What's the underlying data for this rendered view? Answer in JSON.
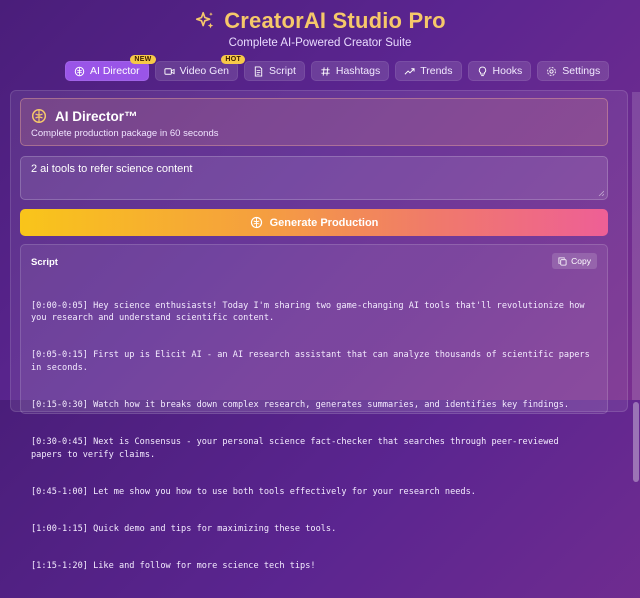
{
  "app": {
    "title": "CreatorAI Studio Pro",
    "subtitle": "Complete AI-Powered Creator Suite",
    "accent": "#9a55e8",
    "title_color": "#f6c86a"
  },
  "tabs": [
    {
      "label": "AI Director",
      "icon": "brain-icon",
      "badge": "NEW",
      "active": true
    },
    {
      "label": "Video Gen",
      "icon": "video-icon",
      "badge": "HOT",
      "active": false
    },
    {
      "label": "Script",
      "icon": "document-icon",
      "badge": "",
      "active": false
    },
    {
      "label": "Hashtags",
      "icon": "hash-icon",
      "badge": "",
      "active": false
    },
    {
      "label": "Trends",
      "icon": "trend-icon",
      "badge": "",
      "active": false
    },
    {
      "label": "Hooks",
      "icon": "lightbulb-icon",
      "badge": "",
      "active": false
    },
    {
      "label": "Settings",
      "icon": "gear-icon",
      "badge": "",
      "active": false
    }
  ],
  "director": {
    "title": "AI Director™",
    "description": "Complete production package in 60 seconds",
    "icon": "brain-icon"
  },
  "prompt": {
    "value": "2 ai tools to refer science content"
  },
  "generate_button": {
    "label": "Generate Production",
    "icon": "brain-icon"
  },
  "script": {
    "label": "Script",
    "copy_label": "Copy",
    "lines": [
      "[0:00-0:05] Hey science enthusiasts! Today I'm sharing two game-changing AI tools that'll revolutionize how you research and understand scientific content.",
      "[0:05-0:15] First up is Elicit AI - an AI research assistant that can analyze thousands of scientific papers in seconds.",
      "[0:15-0:30] Watch how it breaks down complex research, generates summaries, and identifies key findings.",
      "[0:30-0:45] Next is Consensus - your personal science fact-checker that searches through peer-reviewed papers to verify claims.",
      "[0:45-1:00] Let me show you how to use both tools effectively for your research needs.",
      "[1:00-1:15] Quick demo and tips for maximizing these tools.",
      "[1:15-1:20] Like and follow for more science tech tips!"
    ]
  }
}
